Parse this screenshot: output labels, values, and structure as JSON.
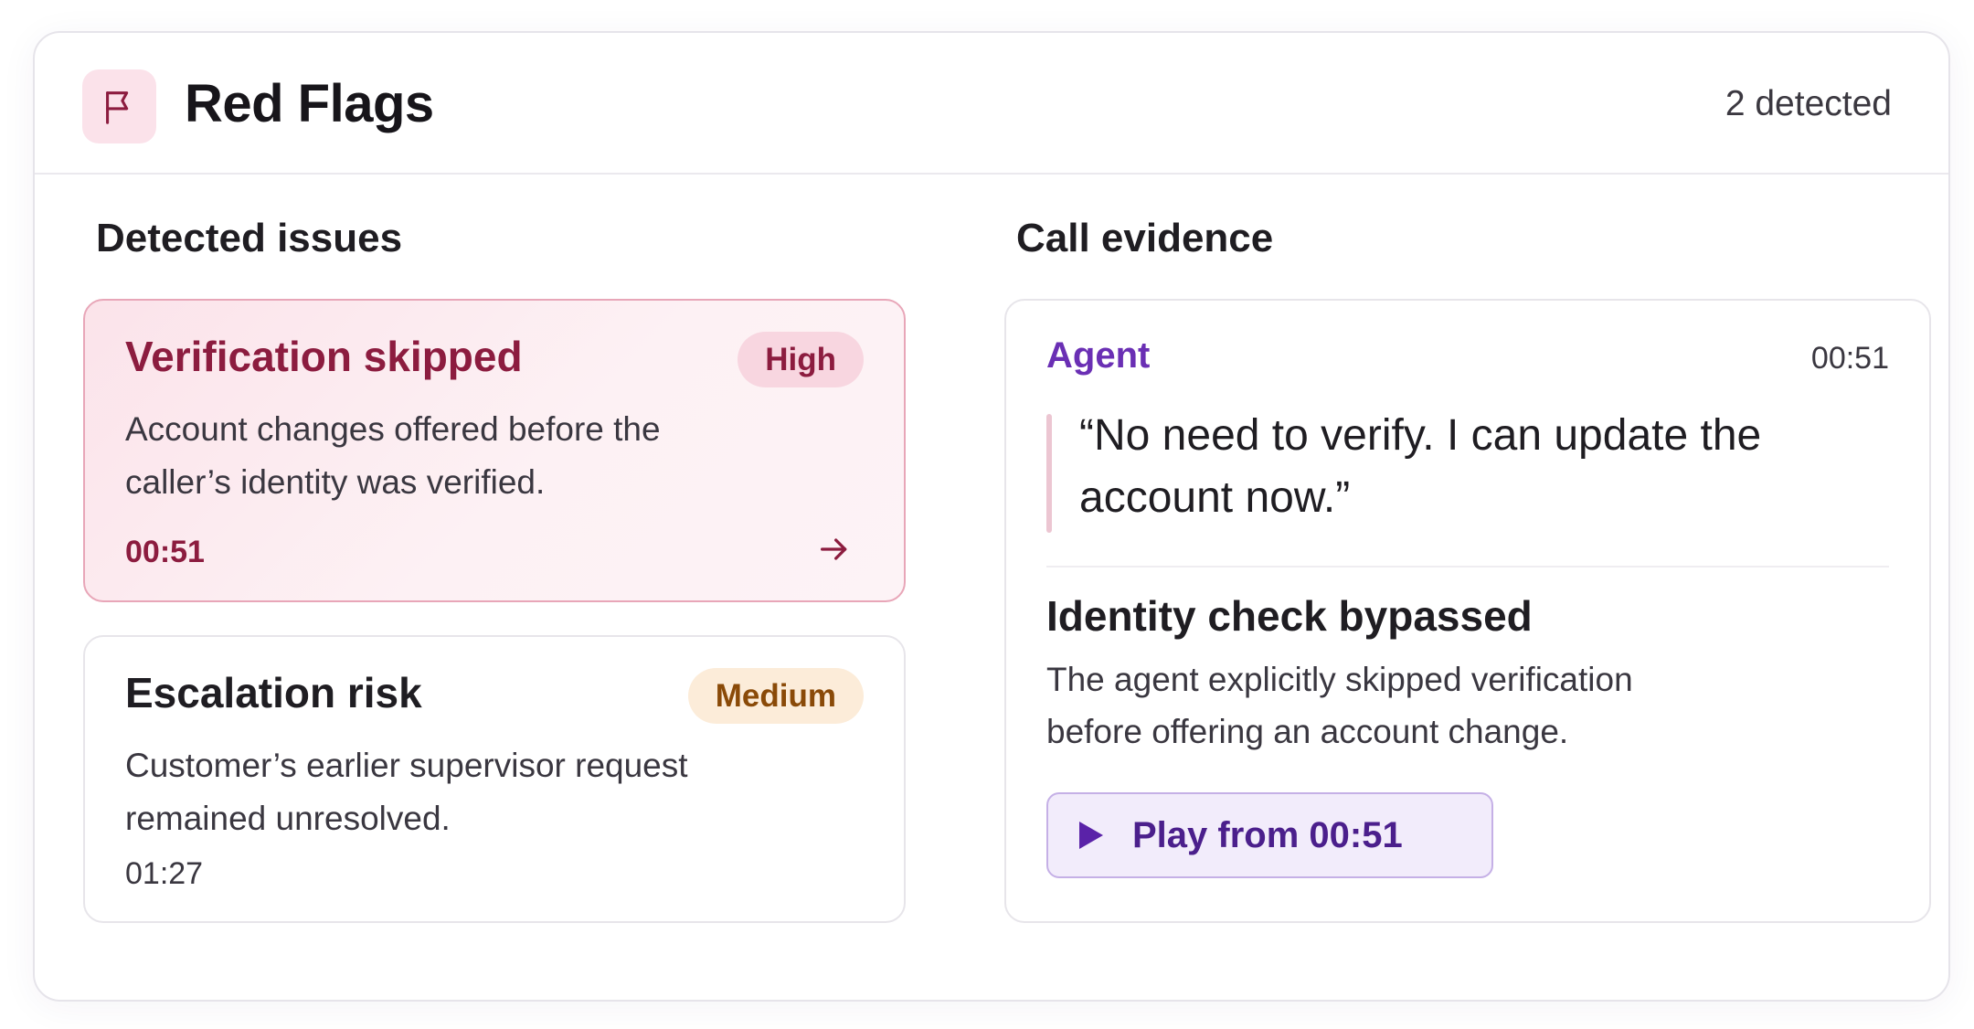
{
  "header": {
    "title": "Red Flags",
    "count": "2 detected",
    "icon": "flag-icon",
    "accent": "#8c1c3f"
  },
  "sections": {
    "issues_heading": "Detected issues",
    "evidence_heading": "Call evidence"
  },
  "issues": [
    {
      "title": "Verification skipped",
      "severity": "High",
      "description": "Account changes offered before the caller’s identity was verified.",
      "time": "00:51",
      "selected": true,
      "color": "#8c1c3f"
    },
    {
      "title": "Escalation risk",
      "severity": "Medium",
      "description": "Customer’s earlier supervisor request remained unresolved.",
      "time": "01:27",
      "selected": false,
      "color": "#8a4a08"
    }
  ],
  "evidence": {
    "speaker": "Agent",
    "time": "00:51",
    "quote": "“No need to verify. I can update the account now.”",
    "title": "Identity check bypassed",
    "description": "The agent explicitly skipped verification before offering an account change.",
    "play_label": "Play from 00:51",
    "speaker_color": "#6a2fb4"
  }
}
